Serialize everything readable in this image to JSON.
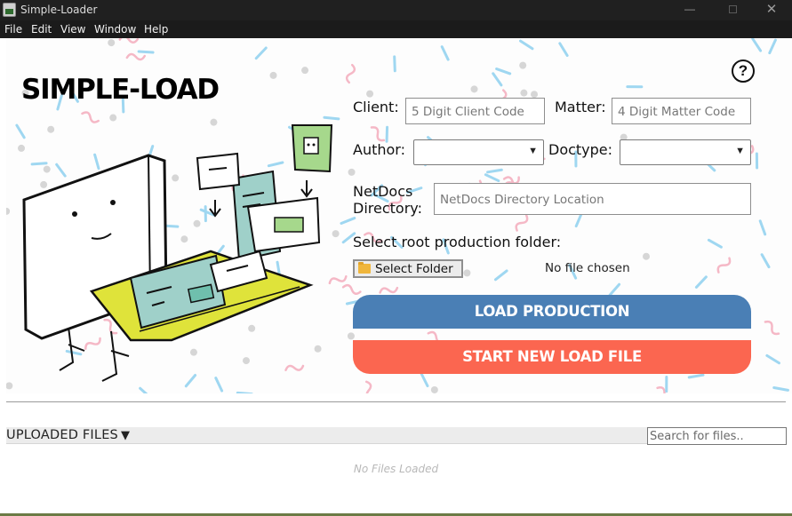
{
  "window": {
    "title": "Simple-Loader",
    "controls": {
      "minimize": "—",
      "close": "✕"
    }
  },
  "menu": [
    "File",
    "Edit",
    "View",
    "Window",
    "Help"
  ],
  "header": {
    "logo": "SIMPLE-LOAD",
    "help": "?"
  },
  "form": {
    "client_label": "Client:",
    "client_placeholder": "5 Digit Client Code",
    "matter_label": "Matter:",
    "matter_placeholder": "4 Digit Matter Code",
    "author_label": "Author:",
    "author_value": "",
    "doctype_label": "Doctype:",
    "doctype_value": "",
    "netdocs_label_line1": "NetDocs",
    "netdocs_label_line2": "Directory:",
    "netdocs_placeholder": "NetDocs Directory Location",
    "root_label": "Select root production folder:",
    "folder_button": "Select Folder",
    "file_status": "No file chosen"
  },
  "actions": {
    "load": "LOAD PRODUCTION",
    "new_load": "START NEW LOAD FILE"
  },
  "files": {
    "title": "UPLOADED FILES",
    "caret": "▼",
    "search_placeholder": "Search for files..",
    "empty_text": "No Files Loaded"
  },
  "colors": {
    "load_button": "#4a7fb5",
    "new_load_button": "#fb6650",
    "titlebar": "#202020"
  },
  "icons": [
    "app-icon",
    "help-icon",
    "folder-icon",
    "chevron-down-icon"
  ]
}
